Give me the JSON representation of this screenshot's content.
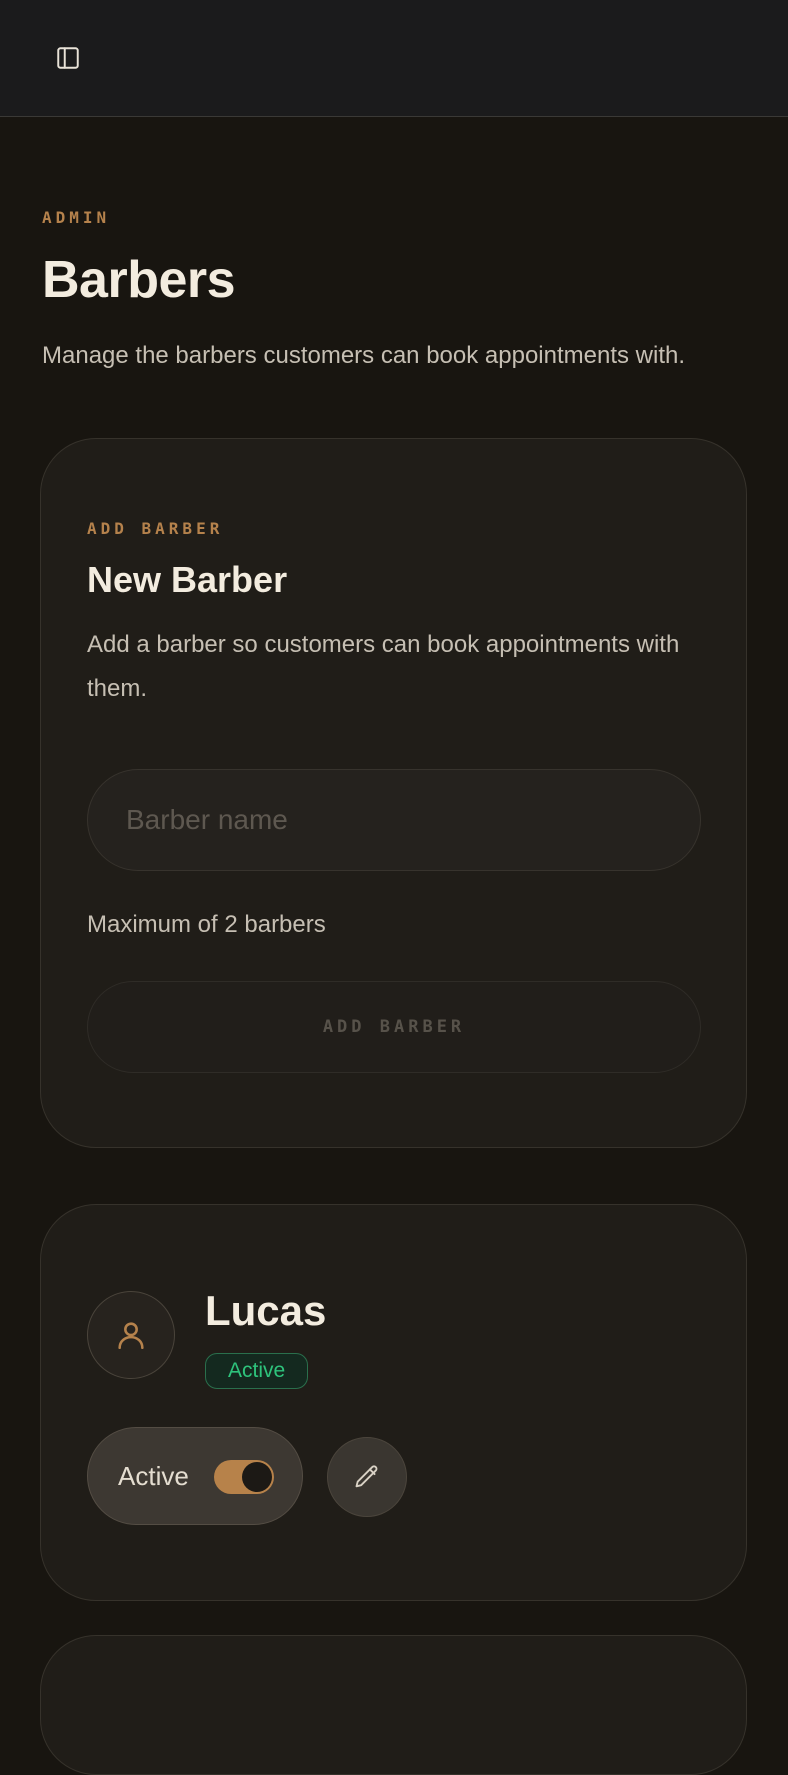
{
  "topbar": {
    "toggle_icon": "sidebar-panel-icon"
  },
  "header": {
    "eyebrow": "ADMIN",
    "title": "Barbers",
    "subtitle": "Manage the barbers customers can book appointments with."
  },
  "add_card": {
    "eyebrow": "ADD BARBER",
    "title": "New Barber",
    "description": "Add a barber so customers can book appointments with them.",
    "name_input": {
      "value": "",
      "placeholder": "Barber name"
    },
    "helper": "Maximum of 2 barbers",
    "button_label": "ADD BARBER",
    "button_disabled": true
  },
  "barbers": [
    {
      "name": "Lucas",
      "status": "Active",
      "toggle_label": "Active",
      "toggle_on": true,
      "avatar_icon": "user-icon",
      "edit_icon": "pencil-icon"
    }
  ],
  "colors": {
    "accent": "#b5824c",
    "background": "#181510",
    "card": "#201d18",
    "status_active": "#2ec37c"
  }
}
